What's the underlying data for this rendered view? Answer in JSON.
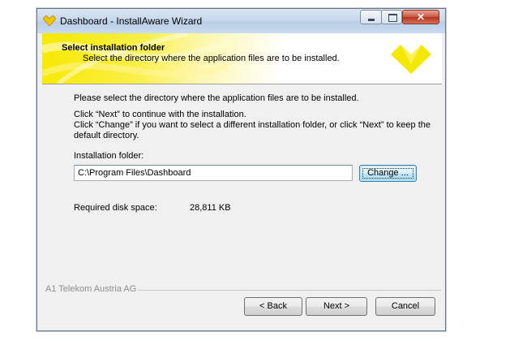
{
  "window": {
    "title": "Dashboard - InstallAware Wizard",
    "controls": {
      "minimize": "minimize-icon",
      "maximize": "maximize-icon",
      "close": "close-icon"
    }
  },
  "header": {
    "title": "Select installation folder",
    "subtitle": "Select the directory where the application files are to be installed."
  },
  "body": {
    "intro": "Please select the directory where the application files are to be installed.",
    "continue_text": "Click “Next” to continue with the installation.",
    "change_text": "Click “Change” if you want to select a different installation folder, or click “Next” to keep the default directory.",
    "folder_label": "Installation folder:",
    "folder_value": "C:\\Program Files\\Dashboard",
    "change_button": "Change ...",
    "disk_label": "Required disk space:",
    "disk_value": "28,811 KB"
  },
  "footer": {
    "brand": "A1 Telekom Austria AG",
    "back": "< Back",
    "next": "Next >",
    "cancel": "Cancel"
  },
  "colors": {
    "accent": "#f6e900",
    "header_gradient_end": "#ffffff",
    "button_border": "#707070"
  }
}
